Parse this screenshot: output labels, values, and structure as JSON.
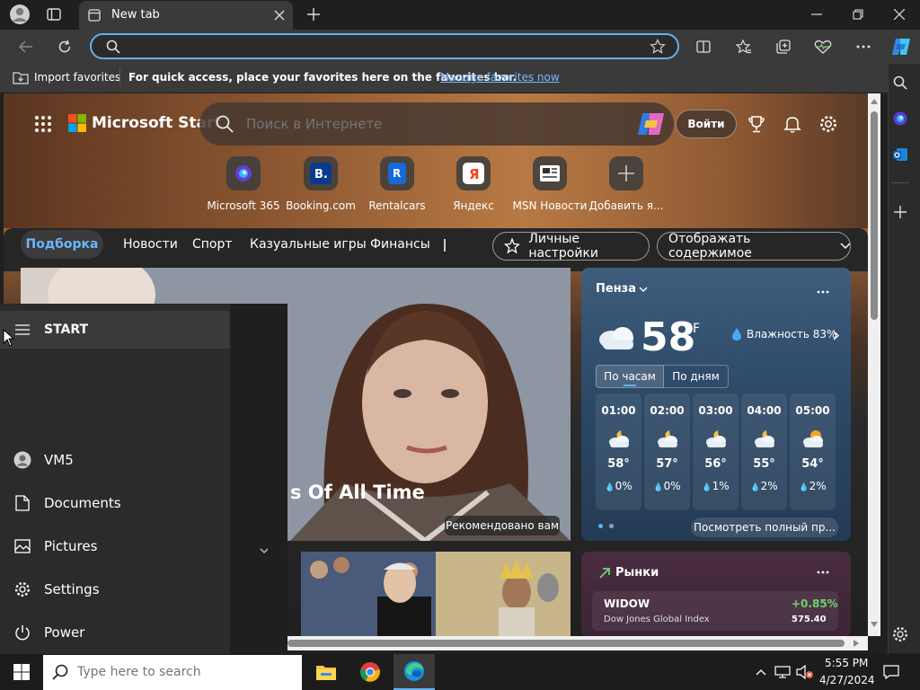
{
  "browser": {
    "tab_title": "New tab",
    "address_placeholder": "",
    "favorites_bar": {
      "import_label": "Import favorites",
      "hint_text": "For quick access, place your favorites here on the favorites bar.",
      "manage_link": "Manage favorites now"
    }
  },
  "msn": {
    "brand": "Microsoft Start",
    "search_placeholder": "Поиск в Интернете",
    "login_label": "Войти",
    "quick_links": [
      {
        "label": "Microsoft 365"
      },
      {
        "label": "Booking.com"
      },
      {
        "label": "Rentalcars"
      },
      {
        "label": "Яндекс"
      },
      {
        "label": "MSN Новости"
      },
      {
        "label": "Добавить я..."
      }
    ],
    "nav_tabs": [
      "Подборка",
      "Новости",
      "Спорт",
      "Казуальные игры",
      "Финансы"
    ],
    "personalize_label": "Личные настройки",
    "display_content_label": "Отображать содержимое",
    "hero": {
      "title_fragment": "s Of All Time",
      "badge": "Рекомендовано вам"
    },
    "weather": {
      "city": "Пенза",
      "temp": "58",
      "unit": "°F",
      "humidity": "Влажность 83%",
      "tabs": [
        "По часам",
        "По дням"
      ],
      "hours": [
        {
          "time": "01:00",
          "temp": "58°",
          "prec": "0%"
        },
        {
          "time": "02:00",
          "temp": "57°",
          "prec": "0%"
        },
        {
          "time": "03:00",
          "temp": "56°",
          "prec": "1%"
        },
        {
          "time": "04:00",
          "temp": "55°",
          "prec": "2%"
        },
        {
          "time": "05:00",
          "temp": "54°",
          "prec": "2%"
        }
      ],
      "full_forecast": "Посмотреть полный пр..."
    },
    "markets": {
      "title": "Рынки",
      "symbol": "WIDOW",
      "name": "Dow Jones Global Index",
      "change": "+0.85%",
      "value": "575.40"
    }
  },
  "start_menu": {
    "title": "START",
    "items": [
      {
        "label": "VM5",
        "icon": "user-icon"
      },
      {
        "label": "Documents",
        "icon": "document-icon"
      },
      {
        "label": "Pictures",
        "icon": "pictures-icon"
      },
      {
        "label": "Settings",
        "icon": "gear-icon"
      },
      {
        "label": "Power",
        "icon": "power-icon"
      }
    ]
  },
  "taskbar": {
    "search_placeholder": "Type here to search",
    "time": "5:55 PM",
    "date": "4/27/2024"
  },
  "colors": {
    "accent": "#5fb2f2",
    "link": "#7ab7ff",
    "positive": "#6fd36f"
  }
}
